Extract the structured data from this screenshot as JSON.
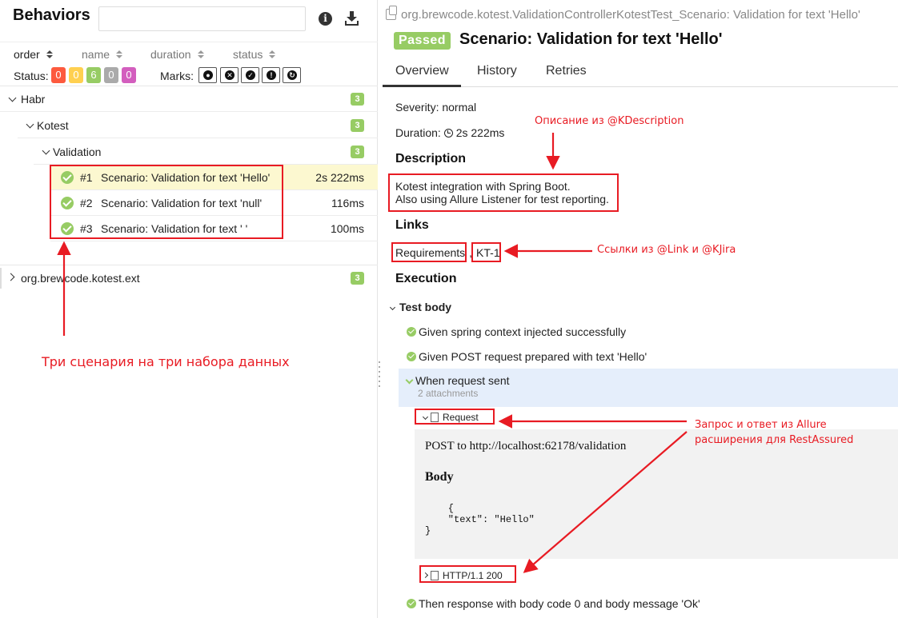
{
  "left": {
    "title": "Behaviors",
    "search_placeholder": "",
    "sort_labels": [
      "order",
      "name",
      "duration",
      "status"
    ],
    "status_label": "Status:",
    "status_counts": [
      {
        "value": "0",
        "color": "#fd5a3e"
      },
      {
        "value": "0",
        "color": "#ffd050"
      },
      {
        "value": "6",
        "color": "#97cc64"
      },
      {
        "value": "0",
        "color": "#aaaaaa"
      },
      {
        "value": "0",
        "color": "#d35ebe"
      }
    ],
    "marks_label": "Marks:",
    "marks_icons": [
      "bomb-icon",
      "close-circle-icon",
      "check-circle-icon",
      "exclamation-circle-icon",
      "refresh-icon"
    ],
    "tree": {
      "habr": {
        "label": "Habr",
        "count": "3"
      },
      "kotest": {
        "label": "Kotest",
        "count": "3"
      },
      "validation": {
        "label": "Validation",
        "count": "3"
      },
      "cases": [
        {
          "num": "#1",
          "name": "Scenario: Validation for text 'Hello'",
          "duration": "2s 222ms"
        },
        {
          "num": "#2",
          "name": "Scenario: Validation for text 'null'",
          "duration": "116ms"
        },
        {
          "num": "#3",
          "name": "Scenario: Validation for text ' '",
          "duration": "100ms"
        }
      ],
      "ext": {
        "label": "org.brewcode.kotest.ext",
        "count": "3"
      }
    }
  },
  "right": {
    "breadcrumb": "org.brewcode.kotest.ValidationControllerKotestTest_Scenario: Validation for text 'Hello'",
    "status_badge": "Passed",
    "title": "Scenario: Validation for text 'Hello'",
    "tabs": [
      "Overview",
      "History",
      "Retries"
    ],
    "severity": "Severity: normal",
    "duration_label": "Duration:",
    "duration_value": "2s 222ms",
    "description_title": "Description",
    "description_lines": [
      "Kotest integration with Spring Boot.",
      "Also using Allure Listener for test reporting."
    ],
    "links_title": "Links",
    "links": [
      "Requirements",
      "KT-1"
    ],
    "links_sep": ",",
    "execution_title": "Execution",
    "test_body_label": "Test body",
    "steps": [
      "Given spring context injected successfully",
      "Given POST request prepared with text 'Hello'",
      "When request sent",
      "Then response with body code 0 and body message 'Ok'"
    ],
    "attachments_count": "2 attachments",
    "attachments": [
      "Request",
      "HTTP/1.1 200"
    ],
    "request": {
      "line": "POST to http://localhost:62178/validation",
      "body_title": "Body",
      "body_code": "    {\n    \"text\": \"Hello\"\n}"
    }
  },
  "annotations": {
    "description": "Описание из @KDescription",
    "links": "Ссылки из @Link и @KJira",
    "scenarios": "Три сценария на три набора данных",
    "rest_line1": "Запрос и ответ из Allure",
    "rest_line2": "расширения для RestAssured",
    "color": "#e81b23"
  }
}
